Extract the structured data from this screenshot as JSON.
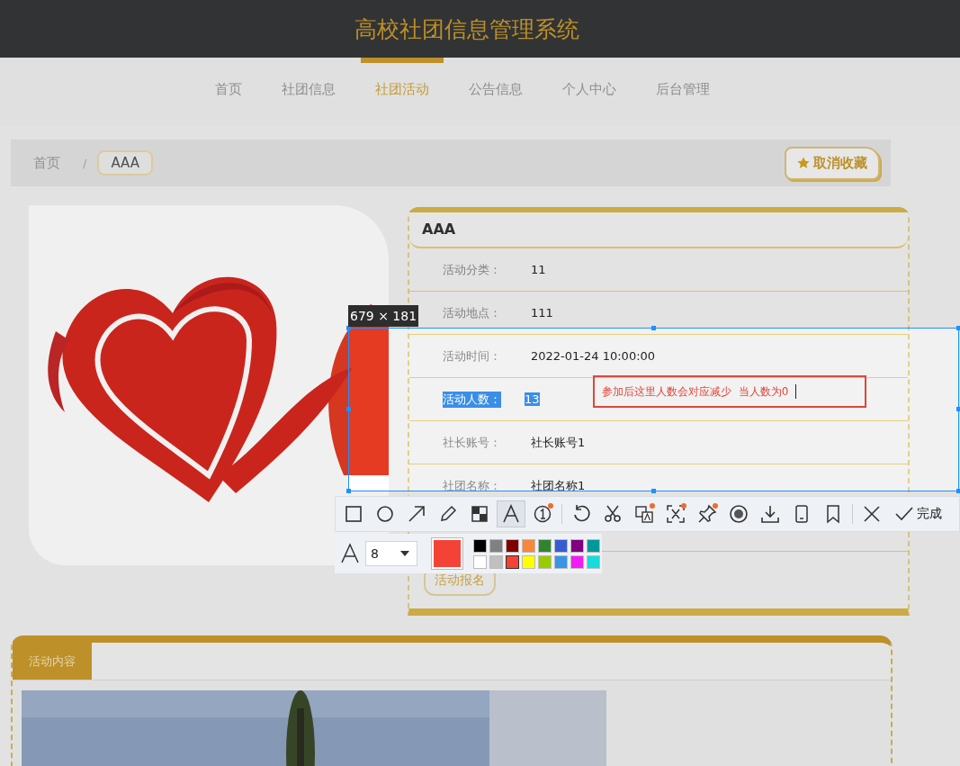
{
  "header": {
    "title": "高校社团信息管理系统"
  },
  "nav": [
    {
      "label": "首页",
      "selected": false
    },
    {
      "label": "社团信息",
      "selected": false
    },
    {
      "label": "社团活动",
      "selected": true
    },
    {
      "label": "公告信息",
      "selected": false
    },
    {
      "label": "个人中心",
      "selected": false
    },
    {
      "label": "后台管理",
      "selected": false
    }
  ],
  "breadcrumb": {
    "items": [
      {
        "label": "首页",
        "current": false
      },
      {
        "label": "AAA",
        "current": true
      }
    ],
    "separator": "/"
  },
  "favorite_button": {
    "label": "取消收藏"
  },
  "activity": {
    "title": "AAA",
    "fields": [
      {
        "label": "活动分类：",
        "value": "11",
        "highlighted": false
      },
      {
        "label": "活动地点：",
        "value": "111",
        "highlighted": false
      },
      {
        "label": "活动时间：",
        "value": "2022-01-24 10:00:00",
        "highlighted": false
      },
      {
        "label": "活动人数：",
        "value": "13",
        "highlighted": true
      },
      {
        "label": "社长账号：",
        "value": "社长账号1",
        "highlighted": false
      },
      {
        "label": "社团名称：",
        "value": "社团名称1",
        "highlighted": false
      }
    ],
    "signup_button": "活动报名"
  },
  "content_panel": {
    "tab": "活动内容"
  },
  "capture": {
    "size_label": "679 × 181",
    "annotation": {
      "text": "参加后这里人数会对应减少  当人数为0",
      "color": "#e0453a"
    },
    "tool_groups": [
      [
        {
          "kind": "rectangle",
          "selected": false,
          "dot": false
        },
        {
          "kind": "ellipse",
          "selected": false,
          "dot": false
        },
        {
          "kind": "arrow",
          "selected": false,
          "dot": false
        },
        {
          "kind": "pencil",
          "selected": false,
          "dot": false
        },
        {
          "kind": "mosaic",
          "selected": false,
          "dot": false
        },
        {
          "kind": "text",
          "selected": true,
          "dot": false
        },
        {
          "kind": "number",
          "selected": false,
          "dot": true
        }
      ],
      [
        {
          "kind": "undo",
          "selected": false,
          "dot": false
        },
        {
          "kind": "scissors",
          "selected": false,
          "dot": false
        },
        {
          "kind": "translate",
          "selected": false,
          "dot": true
        },
        {
          "kind": "ocr",
          "selected": false,
          "dot": true
        },
        {
          "kind": "pin",
          "selected": false,
          "dot": true
        },
        {
          "kind": "record",
          "selected": false,
          "dot": false
        },
        {
          "kind": "download",
          "selected": false,
          "dot": false
        },
        {
          "kind": "phone",
          "selected": false,
          "dot": false
        },
        {
          "kind": "bookmark",
          "selected": false,
          "dot": false
        }
      ],
      [
        {
          "kind": "close",
          "selected": false,
          "dot": false
        }
      ]
    ],
    "done_button": "完成",
    "font_size": "8",
    "palette": [
      {
        "color": "#000000",
        "selected": false
      },
      {
        "color": "#808080",
        "selected": false
      },
      {
        "color": "#800000",
        "selected": false
      },
      {
        "color": "#f7883a",
        "selected": false
      },
      {
        "color": "#308430",
        "selected": false
      },
      {
        "color": "#385ad3",
        "selected": false
      },
      {
        "color": "#800080",
        "selected": false
      },
      {
        "color": "#009999",
        "selected": false
      },
      {
        "color": "#ffffff",
        "selected": false
      },
      {
        "color": "#c0c0c0",
        "selected": false
      },
      {
        "color": "#f44336",
        "selected": true
      },
      {
        "color": "#ffff00",
        "selected": false
      },
      {
        "color": "#99cc00",
        "selected": false
      },
      {
        "color": "#3894e4",
        "selected": false
      },
      {
        "color": "#f31bf3",
        "selected": false
      },
      {
        "color": "#16dcdc",
        "selected": false
      }
    ]
  }
}
